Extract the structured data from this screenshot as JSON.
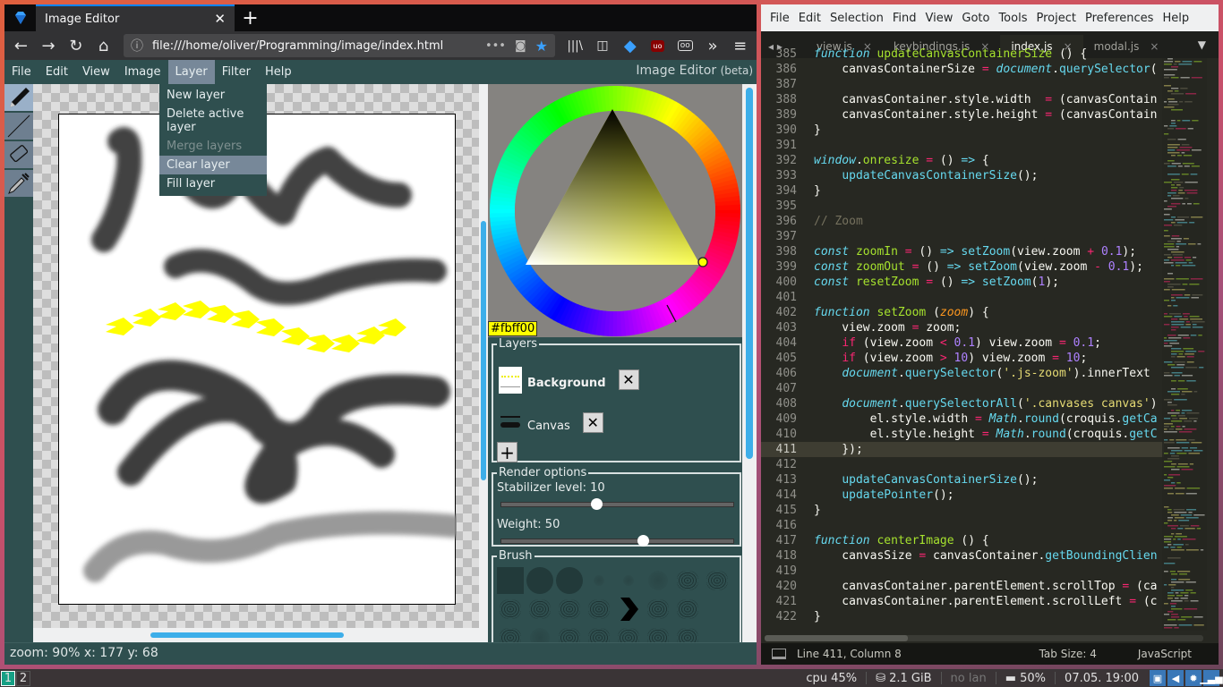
{
  "browser": {
    "tab_title": "Image Editor",
    "url": "file:///home/oliver/Programming/image/index.html",
    "page_actions": "•••"
  },
  "app": {
    "menu": [
      "File",
      "Edit",
      "View",
      "Image",
      "Layer",
      "Filter",
      "Help"
    ],
    "active_menu": "Layer",
    "brand": "Image Editor",
    "brand_suffix": "(beta)",
    "layer_menu": [
      {
        "label": "New layer",
        "state": "enabled"
      },
      {
        "label": "Delete active layer",
        "state": "enabled"
      },
      {
        "label": "Merge layers",
        "state": "disabled"
      },
      {
        "label": "Clear layer",
        "state": "hovered"
      },
      {
        "label": "Fill layer",
        "state": "enabled"
      }
    ],
    "tools": [
      "pencil",
      "line",
      "eraser",
      "eyedropper"
    ],
    "active_tool": "pencil",
    "color_hex": "#fbff00",
    "layers_legend": "Layers",
    "layers": [
      {
        "name": "Background",
        "active": true
      },
      {
        "name": "Canvas",
        "active": false
      }
    ],
    "add_layer_label": "+",
    "delete_label": "✕",
    "render_legend": "Render options",
    "stabilizer_label": "Stabilizer level: 10",
    "stabilizer_fraction": 0.41,
    "weight_label": "Weight: 50",
    "weight_fraction": 0.61,
    "brush_legend": "Brush",
    "status": "zoom: 90% x: 177 y: 68"
  },
  "editor": {
    "menu": [
      "File",
      "Edit",
      "Selection",
      "Find",
      "View",
      "Goto",
      "Tools",
      "Project",
      "Preferences",
      "Help"
    ],
    "tabs": [
      {
        "name": "view.js",
        "active": false
      },
      {
        "name": "keybindings.js",
        "active": false
      },
      {
        "name": "index.js",
        "active": true
      },
      {
        "name": "modal.js",
        "active": false
      }
    ],
    "close_glyph": "×",
    "status_position": "Line 411, Column 8",
    "status_tab": "Tab Size: 4",
    "status_syntax": "JavaScript",
    "lines": [
      {
        "no": "385",
        "html": "<span class='k'>function</span> <span class='f'>updateCanvasContainerSize</span> () {"
      },
      {
        "no": "386",
        "html": "    canvasContainerSize <span class='o'>=</span> <span class='k'>document</span>.<span class='fn'>querySelector</span>("
      },
      {
        "no": "387",
        "html": ""
      },
      {
        "no": "388",
        "html": "    canvasContainer.style.width  <span class='o'>=</span> (canvasContain"
      },
      {
        "no": "389",
        "html": "    canvasContainer.style.height <span class='o'>=</span> (canvasContain"
      },
      {
        "no": "390",
        "html": "}"
      },
      {
        "no": "391",
        "html": ""
      },
      {
        "no": "392",
        "html": "<span class='k'>window</span>.<span class='f'>onresize</span> <span class='o'>=</span> () <span class='fn'>=&gt;</span> {"
      },
      {
        "no": "393",
        "html": "    <span class='fn'>updateCanvasContainerSize</span>();"
      },
      {
        "no": "394",
        "html": "}"
      },
      {
        "no": "395",
        "html": ""
      },
      {
        "no": "396",
        "html": "<span class='c'>// Zoom</span>"
      },
      {
        "no": "397",
        "html": ""
      },
      {
        "no": "398",
        "html": "<span class='k'>const</span> <span class='f'>zoomIn</span> <span class='o'>=</span> () <span class='fn'>=&gt;</span> <span class='fn'>setZoom</span>(view.zoom <span class='o'>+</span> <span class='n'>0.1</span>);"
      },
      {
        "no": "399",
        "html": "<span class='k'>const</span> <span class='f'>zoomOut</span> <span class='o'>=</span> () <span class='fn'>=&gt;</span> <span class='fn'>setZoom</span>(view.zoom <span class='o'>-</span> <span class='n'>0.1</span>);"
      },
      {
        "no": "400",
        "html": "<span class='k'>const</span> <span class='f'>resetZoom</span> <span class='o'>=</span> () <span class='fn'>=&gt;</span> <span class='fn'>setZoom</span>(<span class='n'>1</span>);"
      },
      {
        "no": "401",
        "html": ""
      },
      {
        "no": "402",
        "html": "<span class='k'>function</span> <span class='f'>setZoom</span> (<span class='p'>zoom</span>) {"
      },
      {
        "no": "403",
        "html": "    view.zoom <span class='o'>=</span> zoom;"
      },
      {
        "no": "404",
        "html": "    <span class='o'>if</span> (view.zoom <span class='o'>&lt;</span> <span class='n'>0.1</span>) view.zoom <span class='o'>=</span> <span class='n'>0.1</span>;"
      },
      {
        "no": "405",
        "html": "    <span class='o'>if</span> (view.zoom <span class='o'>&gt;</span> <span class='n'>10</span>) view.zoom <span class='o'>=</span> <span class='n'>10</span>;"
      },
      {
        "no": "406",
        "html": "    <span class='k'>document</span>.<span class='fn'>querySelector</span>(<span class='s'>'.js-zoom'</span>).innerText"
      },
      {
        "no": "407",
        "html": ""
      },
      {
        "no": "408",
        "html": "    <span class='k'>document</span>.<span class='fn'>querySelectorAll</span>(<span class='s'>'.canvases canvas'</span>)"
      },
      {
        "no": "409",
        "html": "        el.style.width <span class='o'>=</span> <span class='k'>Math</span>.<span class='fn'>round</span>(croquis.<span class='fn'>getCa</span>"
      },
      {
        "no": "410",
        "html": "        el.style.height <span class='o'>=</span> <span class='k'>Math</span>.<span class='fn'>round</span>(croquis.<span class='fn'>getC</span>"
      },
      {
        "no": "411",
        "html": "    });",
        "current": true
      },
      {
        "no": "412",
        "html": ""
      },
      {
        "no": "413",
        "html": "    <span class='fn'>updateCanvasContainerSize</span>();"
      },
      {
        "no": "414",
        "html": "    <span class='fn'>updatePointer</span>();"
      },
      {
        "no": "415",
        "html": "}"
      },
      {
        "no": "416",
        "html": ""
      },
      {
        "no": "417",
        "html": "<span class='k'>function</span> <span class='f'>centerImage</span> () {"
      },
      {
        "no": "418",
        "html": "    canvasSize <span class='o'>=</span> canvasContainer.<span class='fn'>getBoundingClien</span>"
      },
      {
        "no": "419",
        "html": ""
      },
      {
        "no": "420",
        "html": "    canvasContainer.parentElement.scrollTop <span class='o'>=</span> (ca"
      },
      {
        "no": "421",
        "html": "    canvasContainer.parentElement.scrollLeft <span class='o'>=</span> (c"
      },
      {
        "no": "422",
        "html": "}"
      }
    ]
  },
  "taskbar": {
    "workspaces": [
      "1",
      "2"
    ],
    "active_workspace": "1",
    "cpu": "cpu  45%",
    "mem": "2.1 GiB",
    "lan": "no lan",
    "battery": "50%",
    "clock": "07.05. 19:00"
  }
}
